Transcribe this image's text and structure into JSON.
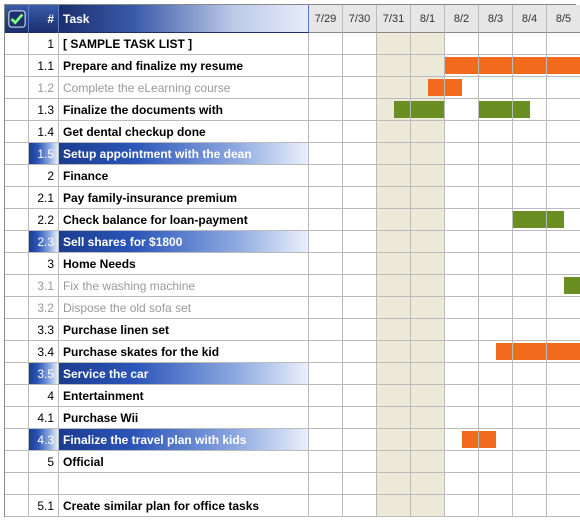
{
  "headers": {
    "check": "✓",
    "num": "#",
    "task": "Task",
    "dates": [
      "7/29",
      "7/30",
      "7/31",
      "8/1",
      "8/2",
      "8/3",
      "8/4",
      "8/5"
    ]
  },
  "shaded_date_cols": [
    2,
    3
  ],
  "rows": [
    {
      "num": "1",
      "task": "[ SAMPLE TASK LIST ]",
      "bold": true,
      "dim": false,
      "hl": false,
      "bars": []
    },
    {
      "num": "1.1",
      "task": "Prepare and finalize my resume",
      "bold": true,
      "dim": false,
      "hl": false,
      "bars": [
        {
          "col": 4,
          "color": "orange",
          "shape": "full"
        },
        {
          "col": 5,
          "color": "orange",
          "shape": "full"
        },
        {
          "col": 6,
          "color": "orange",
          "shape": "full"
        },
        {
          "col": 7,
          "color": "orange",
          "shape": "full"
        }
      ]
    },
    {
      "num": "1.2",
      "task": "Complete the eLearning course",
      "bold": false,
      "dim": true,
      "hl": false,
      "bars": [
        {
          "col": 3,
          "color": "orange",
          "shape": "half-right"
        },
        {
          "col": 4,
          "color": "orange",
          "shape": "half-left"
        }
      ]
    },
    {
      "num": "1.3",
      "task": "Finalize the documents with",
      "bold": true,
      "dim": false,
      "hl": false,
      "bars": [
        {
          "col": 2,
          "color": "green",
          "shape": "half-right"
        },
        {
          "col": 3,
          "color": "green",
          "shape": "full"
        },
        {
          "col": 5,
          "color": "green",
          "shape": "full"
        },
        {
          "col": 6,
          "color": "green",
          "shape": "half-left"
        }
      ]
    },
    {
      "num": "1.4",
      "task": "Get dental checkup done",
      "bold": true,
      "dim": false,
      "hl": false,
      "bars": []
    },
    {
      "num": "1.5",
      "task": "Setup appointment with the dean",
      "bold": true,
      "dim": false,
      "hl": true,
      "bars": []
    },
    {
      "num": "2",
      "task": "Finance",
      "bold": true,
      "dim": false,
      "hl": false,
      "bars": []
    },
    {
      "num": "2.1",
      "task": "Pay family-insurance premium",
      "bold": true,
      "dim": false,
      "hl": false,
      "bars": []
    },
    {
      "num": "2.2",
      "task": "Check balance for loan-payment",
      "bold": true,
      "dim": false,
      "hl": false,
      "bars": [
        {
          "col": 6,
          "color": "green",
          "shape": "full"
        },
        {
          "col": 7,
          "color": "green",
          "shape": "half-left"
        }
      ]
    },
    {
      "num": "2.3",
      "task": "Sell shares for $1800",
      "bold": true,
      "dim": false,
      "hl": true,
      "bars": []
    },
    {
      "num": "3",
      "task": "Home Needs",
      "bold": true,
      "dim": false,
      "hl": false,
      "bars": []
    },
    {
      "num": "3.1",
      "task": "Fix the washing machine",
      "bold": false,
      "dim": true,
      "hl": false,
      "bars": [
        {
          "col": 7,
          "color": "green",
          "shape": "half-right"
        }
      ]
    },
    {
      "num": "3.2",
      "task": "Dispose the old sofa set",
      "bold": false,
      "dim": true,
      "hl": false,
      "bars": []
    },
    {
      "num": "3.3",
      "task": "Purchase linen set",
      "bold": true,
      "dim": false,
      "hl": false,
      "bars": []
    },
    {
      "num": "3.4",
      "task": "Purchase skates for the kid",
      "bold": true,
      "dim": false,
      "hl": false,
      "bars": [
        {
          "col": 5,
          "color": "orange",
          "shape": "half-right"
        },
        {
          "col": 6,
          "color": "orange",
          "shape": "full"
        },
        {
          "col": 7,
          "color": "orange",
          "shape": "full"
        }
      ]
    },
    {
      "num": "3.5",
      "task": "Service the car",
      "bold": true,
      "dim": false,
      "hl": true,
      "bars": []
    },
    {
      "num": "4",
      "task": "Entertainment",
      "bold": true,
      "dim": false,
      "hl": false,
      "bars": []
    },
    {
      "num": "4.1",
      "task": "Purchase Wii",
      "bold": true,
      "dim": false,
      "hl": false,
      "bars": []
    },
    {
      "num": "4.3",
      "task": "Finalize the travel plan with kids",
      "bold": true,
      "dim": false,
      "hl": true,
      "bars": [
        {
          "col": 4,
          "color": "orange",
          "shape": "half-right"
        },
        {
          "col": 5,
          "color": "orange",
          "shape": "half-left"
        }
      ]
    },
    {
      "num": "5",
      "task": "Official",
      "bold": true,
      "dim": false,
      "hl": false,
      "bars": []
    },
    {
      "num": "",
      "task": "",
      "bold": false,
      "dim": false,
      "hl": false,
      "bars": [],
      "blank": true
    },
    {
      "num": "5.1",
      "task": "Create similar plan for office tasks",
      "bold": true,
      "dim": false,
      "hl": false,
      "bars": []
    }
  ]
}
